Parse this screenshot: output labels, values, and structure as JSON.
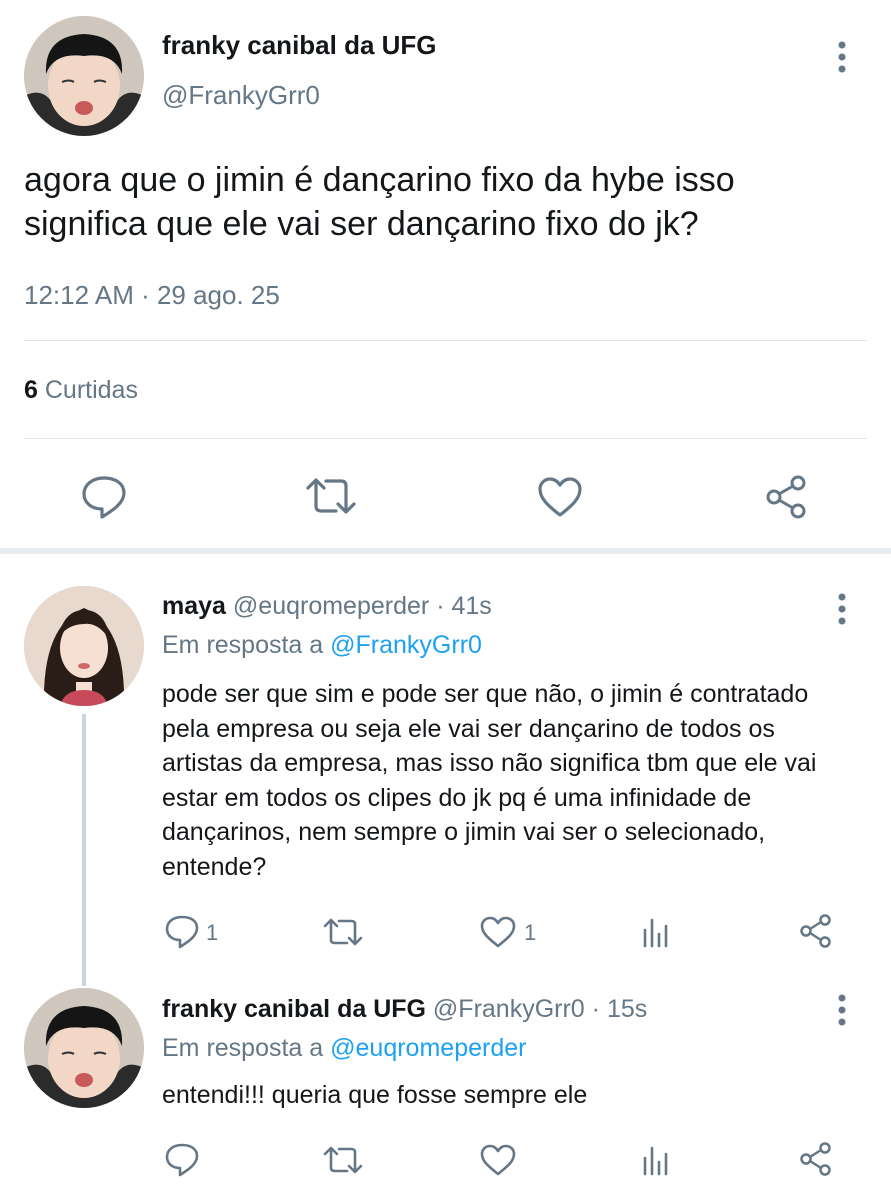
{
  "main_tweet": {
    "display_name": "franky canibal da UFG",
    "handle": "@FrankyGrr0",
    "text": "agora que o jimin é dançarino fixo da hybe isso significa que ele vai ser dançarino fixo do jk?",
    "timestamp": "12:12 AM · 29 ago. 25",
    "likes_count": "6",
    "likes_label": "Curtidas",
    "actions": [
      "reply-icon",
      "retweet-icon",
      "like-icon",
      "share-icon"
    ]
  },
  "replies": [
    {
      "display_name": "maya",
      "handle": "@euqromeperder",
      "time": "· 41s",
      "reply_prefix": "Em resposta a",
      "reply_to": "@FrankyGrr0",
      "text": "pode ser que sim e pode ser que não, o jimin é contratado pela empresa ou seja ele vai ser dançarino de todos os artistas da empresa, mas isso não significa tbm que ele vai estar em todos os clipes do jk pq é uma infinidade de dançarinos, nem sempre o jimin vai ser o selecionado, entende?",
      "reply_count": "1",
      "like_count": "1"
    },
    {
      "display_name": "franky canibal da UFG",
      "handle": "@FrankyGrr0",
      "time": "· 15s",
      "reply_prefix": "Em resposta a",
      "reply_to": "@euqromeperder",
      "text": "entendi!!! queria que fosse sempre ele",
      "reply_count": "",
      "like_count": ""
    }
  ],
  "colors": {
    "text": "#14171a",
    "secondary": "#657786",
    "link": "#1da1f2",
    "divider": "#e1e8ed"
  }
}
